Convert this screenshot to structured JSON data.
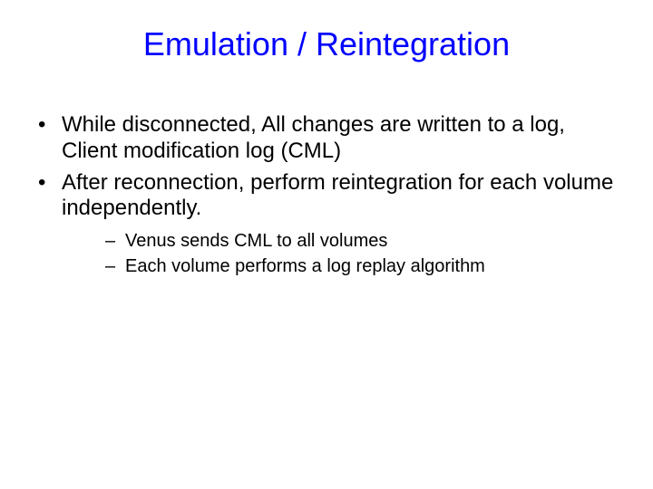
{
  "slide": {
    "title": "Emulation / Reintegration",
    "bullets": [
      "While disconnected, All changes are written to a log, Client modification log (CML)",
      "After reconnection, perform reintegration for each volume independently."
    ],
    "subbullets": [
      "Venus sends CML to all volumes",
      "Each volume performs a log replay algorithm"
    ]
  }
}
